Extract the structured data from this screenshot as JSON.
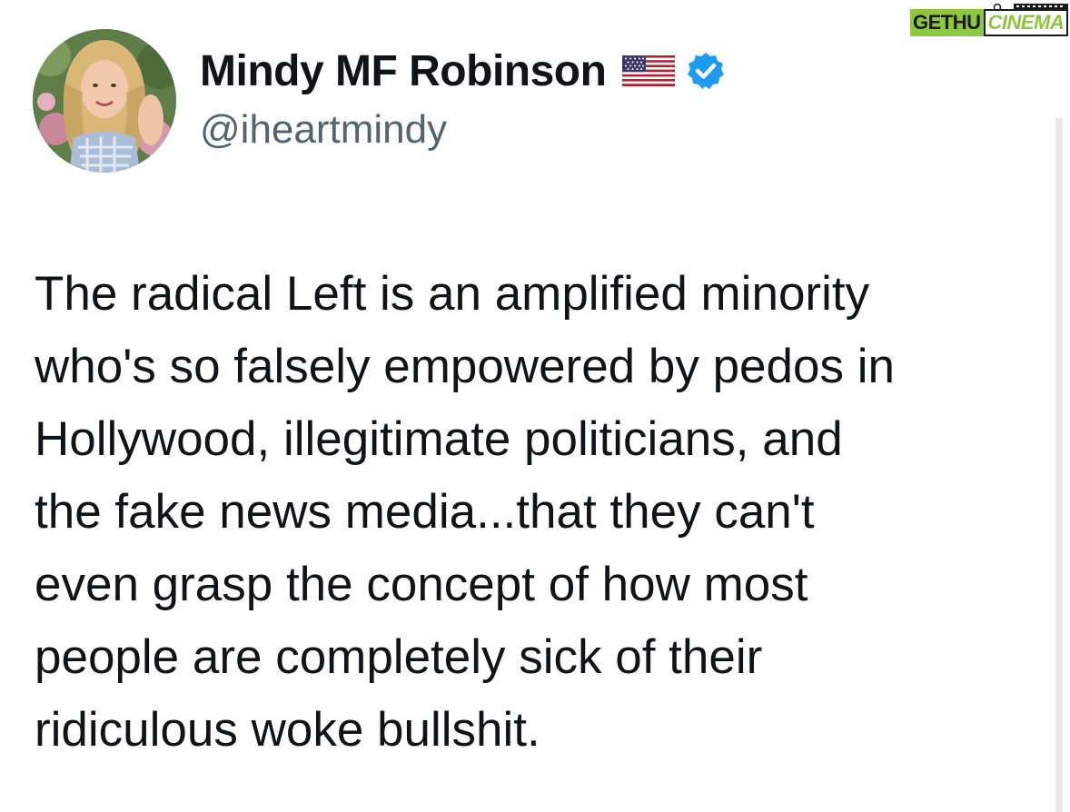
{
  "watermark": {
    "part1": "GETHU",
    "part2": "CINEMA",
    "colors": {
      "green": "#8dc63f",
      "dark": "#1a1a1a"
    }
  },
  "author": {
    "display_name": "Mindy MF Robinson",
    "flag_icon": "us-flag-icon",
    "verified_icon": "verified-badge-icon",
    "handle": "@iheartmindy",
    "avatar": "profile-photo"
  },
  "tweet": {
    "lines": [
      "The radical Left is an amplified minority",
      "who's so falsely empowered by pedos in",
      "Hollywood, illegitimate politicians, and",
      "the fake news media...that they can't",
      "even grasp the concept of how most",
      "people are completely sick of their",
      "ridiculous woke bullshit."
    ]
  },
  "colors": {
    "text": "#0f1419",
    "secondary": "#536471",
    "verified": "#1d9bf0"
  }
}
